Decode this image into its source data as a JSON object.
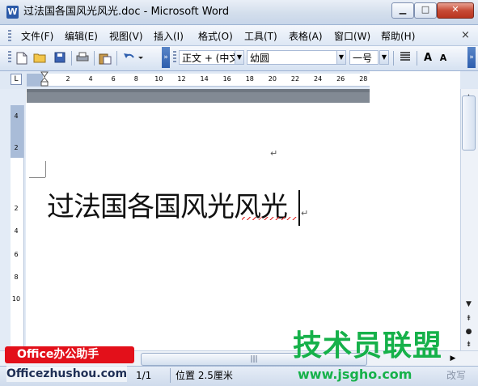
{
  "window": {
    "title": "过法国各国风光风光.doc - Microsoft Word",
    "app_icon": "W",
    "minimize_icon": "minimize-icon",
    "maximize_icon": "maximize-icon",
    "close_icon": "close-icon"
  },
  "menu": {
    "items": [
      "文件(F)",
      "编辑(E)",
      "视图(V)",
      "插入(I)",
      "格式(O)",
      "工具(T)",
      "表格(A)",
      "窗口(W)",
      "帮助(H)"
    ],
    "close_doc_glyph": "×"
  },
  "toolbar": {
    "icons": [
      "new-document-icon",
      "open-folder-icon",
      "save-icon",
      "print-icon",
      "paste-icon",
      "undo-icon"
    ],
    "style_combo": "正文 + (中文",
    "font_combo": "幼圆",
    "size_combo": "一号",
    "grow_font": "A",
    "shrink_font": "A"
  },
  "ruler": {
    "tab_selector": "L",
    "h_ticks": [
      "2",
      "4",
      "6",
      "8",
      "10",
      "12",
      "14",
      "16",
      "18",
      "20",
      "22",
      "24",
      "26",
      "28"
    ],
    "v_ticks": [
      "4",
      "2",
      "2",
      "4",
      "6",
      "8",
      "10"
    ]
  },
  "document": {
    "body_text": "过法国各国风光风光",
    "paragraph_mark": "↵"
  },
  "scrollbar": {
    "up_glyph": "▲",
    "down_glyph": "▼",
    "prev_page_glyph": "⇞",
    "select_browse_glyph": "●",
    "next_page_glyph": "⇟",
    "right_glyph": "▶",
    "thumb_grip": "|||"
  },
  "status": {
    "page_of": "1/1",
    "position": "位置 2.5厘米",
    "ovr": "改写"
  },
  "watermarks": {
    "office_badge": "Office办公助手",
    "office_url": "Officezhushou.com",
    "jsgho_title": "技术员联盟",
    "jsgho_url": "www.jsgho.com"
  },
  "colors": {
    "accent_blue": "#2b5aa8",
    "close_red": "#c74b36",
    "spell_error_red": "#e02020",
    "watermark_green": "#16b14a",
    "watermark_red": "#e3101a"
  }
}
